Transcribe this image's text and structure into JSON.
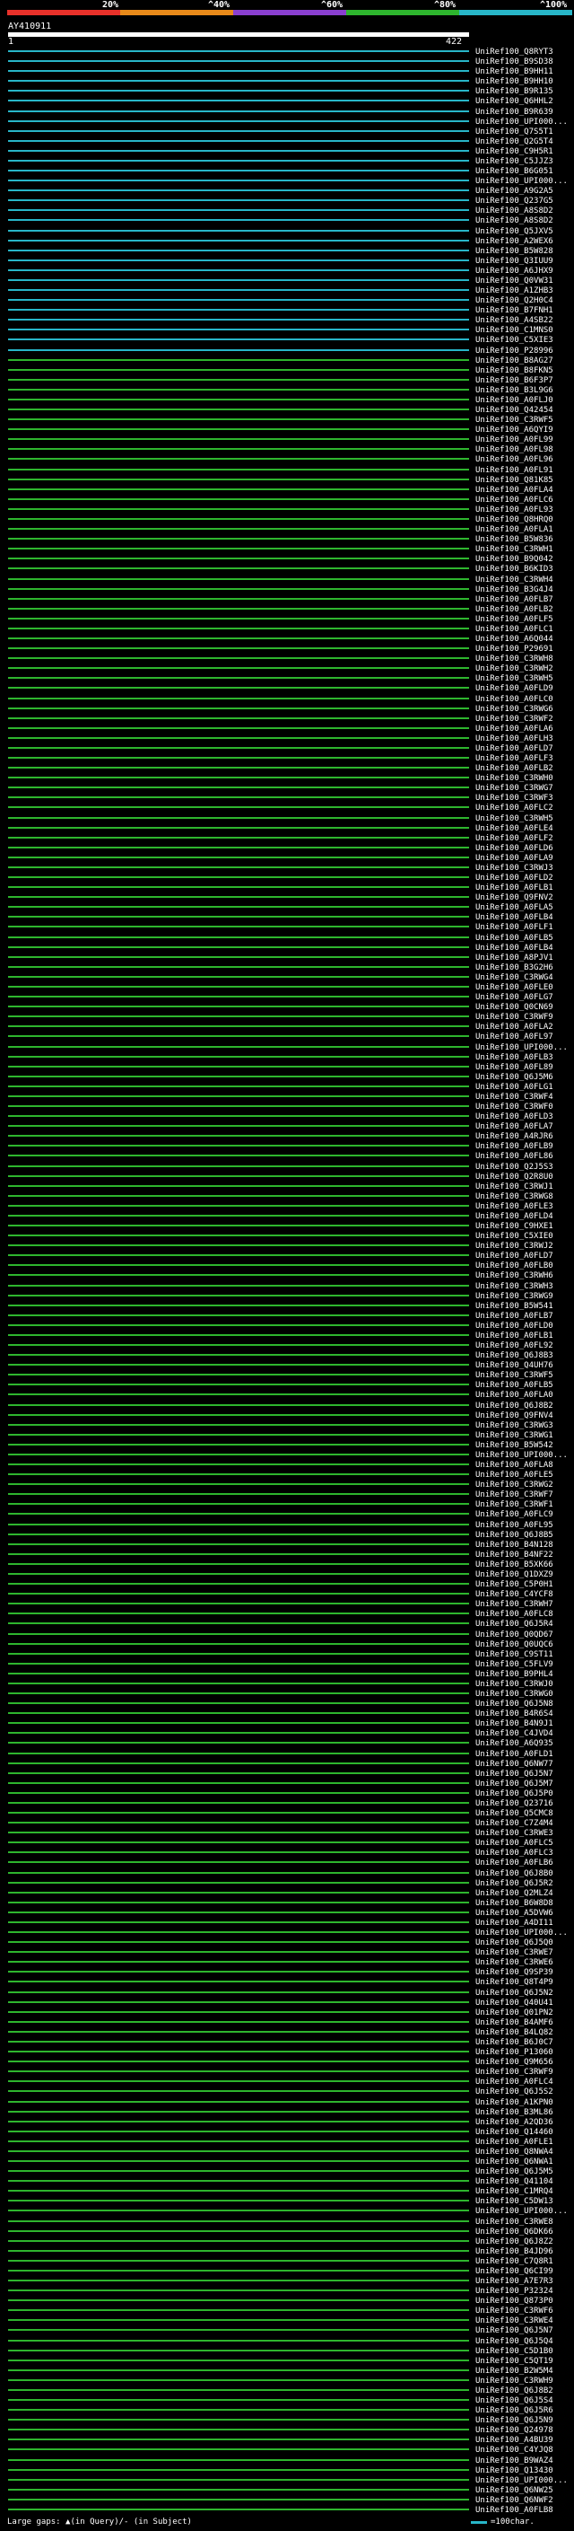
{
  "legend": {
    "labels": [
      "20%",
      "^40%",
      "^60%",
      "^80%",
      "^100%"
    ],
    "colors": [
      "#e8312a",
      "#e88a1a",
      "#8a3fd0",
      "#2eb52e",
      "#28b6c8"
    ]
  },
  "query": {
    "id": "AY410911",
    "start": "1",
    "end": "422"
  },
  "hit_ids": [
    "UniRef100_Q8RYT3",
    "UniRef100_B9SD38",
    "UniRef100_B9HH11",
    "UniRef100_B9HH10",
    "UniRef100_B9R135",
    "UniRef100_Q6HHL2",
    "UniRef100_B9R639",
    "UniRef100_UPI000...",
    "UniRef100_Q7S5T1",
    "UniRef100_Q2G5T4",
    "UniRef100_C9H5R1",
    "UniRef100_C5JJZ3",
    "UniRef100_B6G051",
    "UniRef100_UPI000...",
    "UniRef100_A9G2A5",
    "UniRef100_Q237G5",
    "UniRef100_A8S8D2",
    "UniRef100_A8S8D2",
    "UniRef100_Q5JXV5",
    "UniRef100_A2WEX6",
    "UniRef100_B5W828",
    "UniRef100_Q3IUU9",
    "UniRef100_A6JHX9",
    "UniRef100_Q0VW31",
    "UniRef100_A1ZHB3",
    "UniRef100_Q2H0C4",
    "UniRef100_B7FNH1",
    "UniRef100_A4SB22",
    "UniRef100_C1MNS0",
    "UniRef100_C5XIE3",
    "UniRef100_P28996",
    "UniRef100_B8AG27",
    "UniRef100_B8FKN5",
    "UniRef100_B6F3P7",
    "UniRef100_B3L9G6",
    "UniRef100_A0FLJ0",
    "UniRef100_Q42454",
    "UniRef100_C3RWF5",
    "UniRef100_A6QYI9",
    "UniRef100_A0FL99",
    "UniRef100_A0FL98",
    "UniRef100_A0FL96",
    "UniRef100_A0FL91",
    "UniRef100_Q81K85",
    "UniRef100_A0FLA4",
    "UniRef100_A0FLC6",
    "UniRef100_A0FL93",
    "UniRef100_Q8HRQ0",
    "UniRef100_A0FLA1",
    "UniRef100_B5W836",
    "UniRef100_C3RWH1",
    "UniRef100_B9Q042",
    "UniRef100_B6KID3",
    "UniRef100_C3RWH4",
    "UniRef100_B3G4J4",
    "UniRef100_A0FLB7",
    "UniRef100_A0FLB2",
    "UniRef100_A0FLF5",
    "UniRef100_A0FLC1",
    "UniRef100_A6Q044",
    "UniRef100_P29691",
    "UniRef100_C3RWH8",
    "UniRef100_C3RWH2",
    "UniRef100_C3RWH5",
    "UniRef100_A0FLD9",
    "UniRef100_A0FLC0",
    "UniRef100_C3RWG6",
    "UniRef100_C3RWF2",
    "UniRef100_A0FLA6",
    "UniRef100_A0FLH3",
    "UniRef100_A0FLD7",
    "UniRef100_A0FLF3",
    "UniRef100_A0FLB2",
    "UniRef100_C3RWH0",
    "UniRef100_C3RWG7",
    "UniRef100_C3RWF3",
    "UniRef100_A0FLC2",
    "UniRef100_C3RWH5",
    "UniRef100_A0FLE4",
    "UniRef100_A0FLF2",
    "UniRef100_A0FLD6",
    "UniRef100_A0FLA9",
    "UniRef100_C3RWJ3",
    "UniRef100_A0FLD2",
    "UniRef100_A0FLB1",
    "UniRef100_Q9FNV2",
    "UniRef100_A0FLA5",
    "UniRef100_A0FLB4",
    "UniRef100_A0FLF1",
    "UniRef100_A0FLB5",
    "UniRef100_A0FLB4",
    "UniRef100_A8PJV1",
    "UniRef100_B3G2H6",
    "UniRef100_C3RWG4",
    "UniRef100_A0FLE0",
    "UniRef100_A0FLG7",
    "UniRef100_Q0CN69",
    "UniRef100_C3RWF9",
    "UniRef100_A0FLA2",
    "UniRef100_A0FL97",
    "UniRef100_UPI000...",
    "UniRef100_A0FLB3",
    "UniRef100_A0FL89",
    "UniRef100_Q6J5M6",
    "UniRef100_A0FLG1",
    "UniRef100_C3RWF4",
    "UniRef100_C3RWF0",
    "UniRef100_A0FLD3",
    "UniRef100_A0FLA7",
    "UniRef100_A4RJR6",
    "UniRef100_A0FLB9",
    "UniRef100_A0FL86",
    "UniRef100_Q2J5S3",
    "UniRef100_Q2R8U0",
    "UniRef100_C3RWJ1",
    "UniRef100_C3RWG8",
    "UniRef100_A0FLE3",
    "UniRef100_A0FLD4",
    "UniRef100_C9HXE1",
    "UniRef100_C5XIE0",
    "UniRef100_C3RWJ2",
    "UniRef100_A0FLD7",
    "UniRef100_A0FLB0",
    "UniRef100_C3RWH6",
    "UniRef100_C3RWH3",
    "UniRef100_C3RWG9",
    "UniRef100_B5W541",
    "UniRef100_A0FLB7",
    "UniRef100_A0FLD0",
    "UniRef100_A0FLB1",
    "UniRef100_A0FL92",
    "UniRef100_Q6J8B3",
    "UniRef100_Q4UH76",
    "UniRef100_C3RWF5",
    "UniRef100_A0FLB5",
    "UniRef100_A0FLA0",
    "UniRef100_Q6J8B2",
    "UniRef100_Q9FNV4",
    "UniRef100_C3RWG3",
    "UniRef100_C3RWG1",
    "UniRef100_B5W542",
    "UniRef100_UPI000...",
    "UniRef100_A0FLA8",
    "UniRef100_A0FLE5",
    "UniRef100_C3RWG2",
    "UniRef100_C3RWF7",
    "UniRef100_C3RWF1",
    "UniRef100_A0FLC9",
    "UniRef100_A0FL95",
    "UniRef100_Q6J8B5",
    "UniRef100_B4N128",
    "UniRef100_B4NF22",
    "UniRef100_B5XK66",
    "UniRef100_Q1DXZ9",
    "UniRef100_C5P0H1",
    "UniRef100_C4YCF8",
    "UniRef100_C3RWH7",
    "UniRef100_A0FLC8",
    "UniRef100_Q6J5R4",
    "UniRef100_Q0QD67",
    "UniRef100_Q0UQC6",
    "UniRef100_C9ST11",
    "UniRef100_C5FLV9",
    "UniRef100_B9PHL4",
    "UniRef100_C3RWJ0",
    "UniRef100_C3RWG0",
    "UniRef100_Q6J5N8",
    "UniRef100_B4R6S4",
    "UniRef100_B4N9J1",
    "UniRef100_C4JVD4",
    "UniRef100_A6Q935",
    "UniRef100_A0FLD1",
    "UniRef100_Q6NW77",
    "UniRef100_Q6J5N7",
    "UniRef100_Q6J5M7",
    "UniRef100_Q6J5P0",
    "UniRef100_Q23716",
    "UniRef100_Q5CMC8",
    "UniRef100_C7Z4M4",
    "UniRef100_C3RWE3",
    "UniRef100_A0FLC5",
    "UniRef100_A0FLC3",
    "UniRef100_A0FLB6",
    "UniRef100_Q6J8B0",
    "UniRef100_Q6J5R2",
    "UniRef100_Q2MLZ4",
    "UniRef100_B6W8D8",
    "UniRef100_A5DVW6",
    "UniRef100_A4DI11",
    "UniRef100_UPI000...",
    "UniRef100_Q6J5Q0",
    "UniRef100_C3RWE7",
    "UniRef100_C3RWE6",
    "UniRef100_Q9SP39",
    "UniRef100_Q8T4P9",
    "UniRef100_Q6J5N2",
    "UniRef100_Q40U41",
    "UniRef100_Q01PN2",
    "UniRef100_B4AMF6",
    "UniRef100_B4LQ82",
    "UniRef100_B6J0C7",
    "UniRef100_P13060",
    "UniRef100_Q9M656",
    "UniRef100_C3RWF9",
    "UniRef100_A0FLC4",
    "UniRef100_Q6J5S2",
    "UniRef100_A1KPN0",
    "UniRef100_B3ML86",
    "UniRef100_A2QD36",
    "UniRef100_Q14460",
    "UniRef100_A0FLE1",
    "UniRef100_Q8NWA4",
    "UniRef100_Q6NWA1",
    "UniRef100_Q6J5M5",
    "UniRef100_Q41104",
    "UniRef100_C1MRQ4",
    "UniRef100_C5DW13",
    "UniRef100_UPI000...",
    "UniRef100_C3RWE8",
    "UniRef100_Q6DK66",
    "UniRef100_Q6J8Z2",
    "UniRef100_B4JD96",
    "UniRef100_C7Q8R1",
    "UniRef100_Q6CI99",
    "UniRef100_A7E7R3",
    "UniRef100_P32324",
    "UniRef100_Q873P0",
    "UniRef100_C3RWF6",
    "UniRef100_C3RWE4",
    "UniRef100_Q6J5N7",
    "UniRef100_Q6J5Q4",
    "UniRef100_C5D1B0",
    "UniRef100_C5QT19",
    "UniRef100_B2W5M4",
    "UniRef100_C3RWH9",
    "UniRef100_Q6J8B2",
    "UniRef100_Q6J5S4",
    "UniRef100_Q6J5R6",
    "UniRef100_Q6J5N9",
    "UniRef100_Q24978",
    "UniRef100_A4BU39",
    "UniRef100_C4YJQ8",
    "UniRef100_B9WAZ4",
    "UniRef100_Q13430",
    "UniRef100_UPI000...",
    "UniRef100_Q6NW25",
    "UniRef100_Q6NWF2",
    "UniRef100_A0FLB8"
  ],
  "footer": {
    "gaps_label": "Large gaps: ▲(in Query)/- (in Subject)",
    "scale_label": "=100char."
  }
}
